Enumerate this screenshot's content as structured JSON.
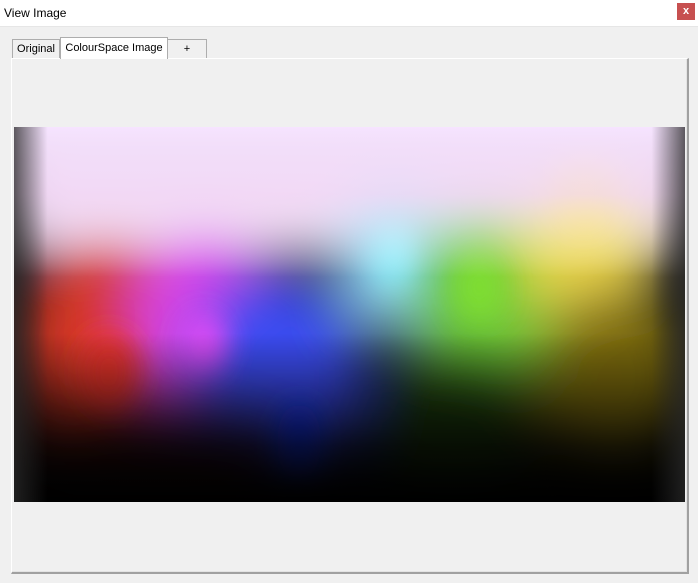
{
  "window": {
    "title": "View Image",
    "close_label": "x"
  },
  "tabs": [
    {
      "label": "Original",
      "active": false
    },
    {
      "label": "ColourSpace Image",
      "active": true
    },
    {
      "label": "+",
      "active": false
    }
  ],
  "image": {
    "description_icon": "colour-space-gradient-image",
    "gradient_stops": [
      "#e03a2a",
      "#e040f0",
      "#0a35ff",
      "#7fe0f5",
      "#7ad838",
      "#f2d840"
    ]
  }
}
